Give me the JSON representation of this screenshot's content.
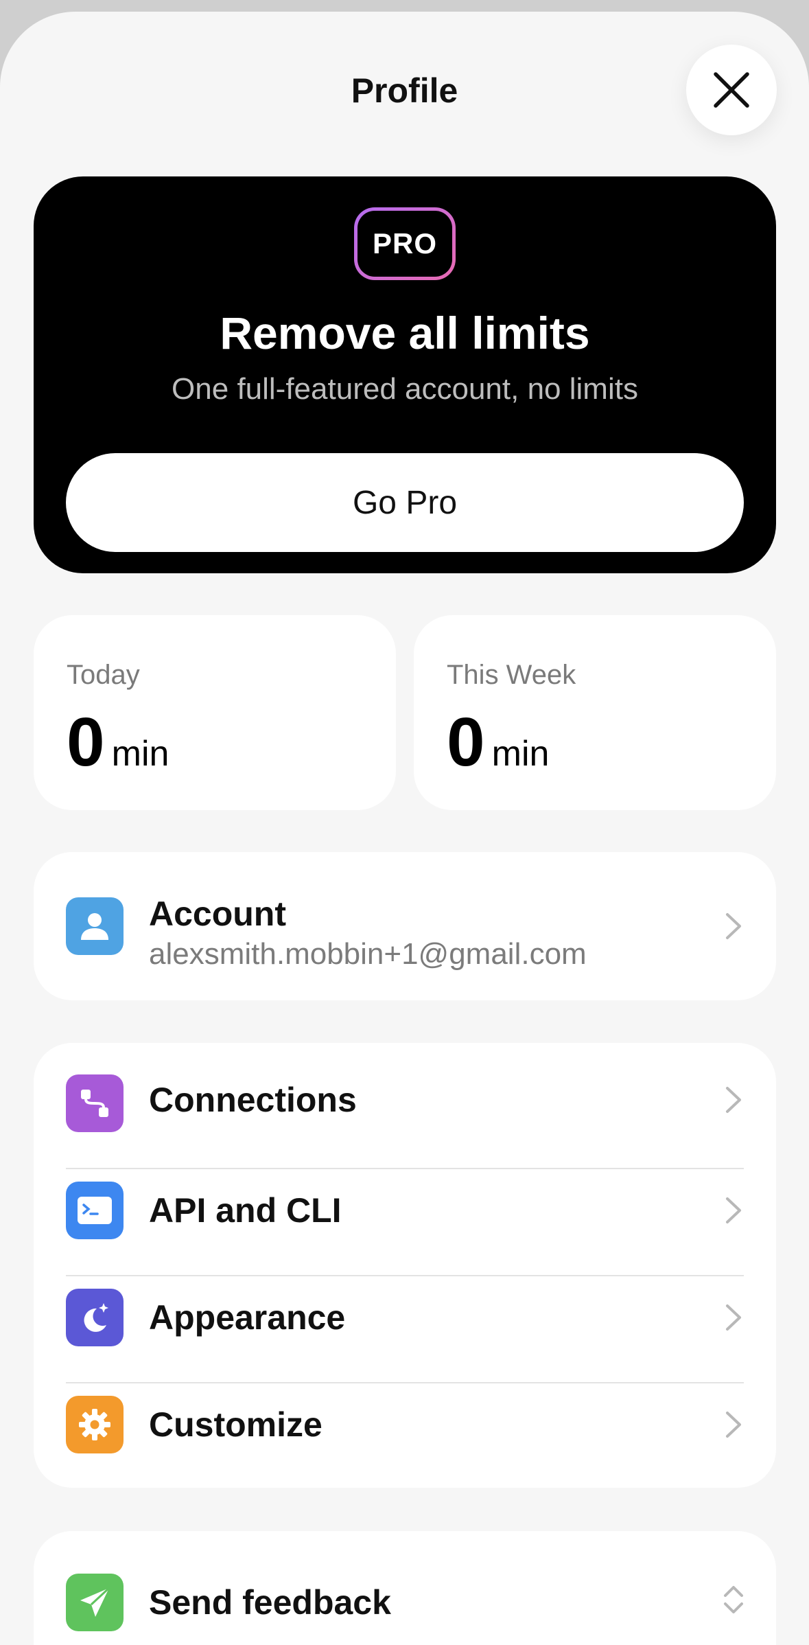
{
  "header": {
    "title": "Profile"
  },
  "pro_card": {
    "badge": "PRO",
    "heading": "Remove all limits",
    "subtitle": "One full-featured account, no limits",
    "button_label": "Go Pro"
  },
  "stats": {
    "today": {
      "label": "Today",
      "value": "0",
      "unit": "min"
    },
    "week": {
      "label": "This Week",
      "value": "0",
      "unit": "min"
    }
  },
  "account": {
    "label": "Account",
    "email": "alexsmith.mobbin+1@gmail.com",
    "icon": "person-icon",
    "color": "#4fa3e3"
  },
  "settings": [
    {
      "label": "Connections",
      "icon": "connections-icon",
      "color": "#a75ad8"
    },
    {
      "label": "API and CLI",
      "icon": "terminal-icon",
      "color": "#3d87f0"
    },
    {
      "label": "Appearance",
      "icon": "moon-stars-icon",
      "color": "#5b58d6"
    },
    {
      "label": "Customize",
      "icon": "gear-icon",
      "color": "#f39a2c"
    }
  ],
  "feedback": {
    "label": "Send feedback",
    "icon": "paper-plane-icon",
    "color": "#5fc35d"
  }
}
